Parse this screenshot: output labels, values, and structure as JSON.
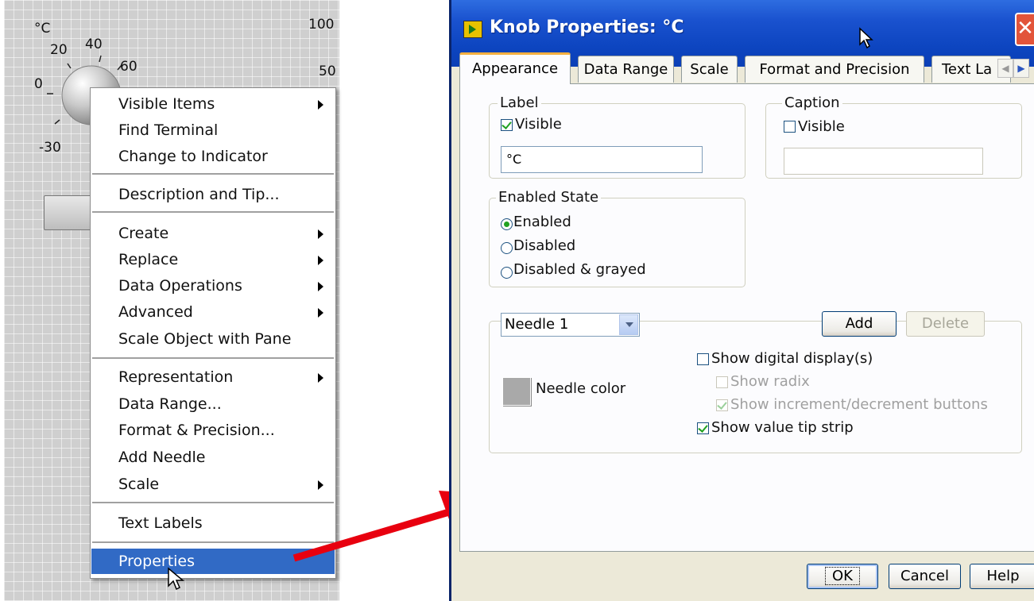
{
  "front_panel": {
    "knob_label": "°C",
    "knob_ticks": [
      "-30",
      "0",
      "20",
      "40",
      "60"
    ],
    "scale_ticks": [
      "100",
      "50"
    ]
  },
  "context_menu": {
    "items": [
      {
        "label": "Visible Items",
        "submenu": true
      },
      {
        "label": "Find Terminal",
        "submenu": false
      },
      {
        "label": "Change to Indicator",
        "submenu": false
      },
      {
        "label": "Description and Tip...",
        "submenu": false
      },
      {
        "label": "Create",
        "submenu": true
      },
      {
        "label": "Replace",
        "submenu": true
      },
      {
        "label": "Data Operations",
        "submenu": true
      },
      {
        "label": "Advanced",
        "submenu": true
      },
      {
        "label": "Scale Object with Pane",
        "submenu": false
      },
      {
        "label": "Representation",
        "submenu": true
      },
      {
        "label": "Data Range...",
        "submenu": false
      },
      {
        "label": "Format & Precision...",
        "submenu": false
      },
      {
        "label": "Add Needle",
        "submenu": false
      },
      {
        "label": "Scale",
        "submenu": true
      },
      {
        "label": "Text Labels",
        "submenu": false
      },
      {
        "label": "Properties",
        "submenu": false,
        "selected": true
      }
    ]
  },
  "dialog": {
    "title": "Knob Properties: °C",
    "close_glyph": "✕",
    "tabs": [
      {
        "label": "Appearance",
        "active": true
      },
      {
        "label": "Data Range",
        "active": false
      },
      {
        "label": "Scale",
        "active": false
      },
      {
        "label": "Format and Precision",
        "active": false
      },
      {
        "label": "Text La",
        "active": false
      }
    ],
    "tab_scroll": {
      "left": "◀",
      "right": "▶"
    },
    "label_group": {
      "legend": "Label",
      "visible_label": "Visible",
      "visible_checked": true,
      "value": "°C"
    },
    "caption_group": {
      "legend": "Caption",
      "visible_label": "Visible",
      "visible_checked": false,
      "value": ""
    },
    "enabled_state": {
      "legend": "Enabled State",
      "options": [
        "Enabled",
        "Disabled",
        "Disabled & grayed"
      ],
      "selected": "Enabled"
    },
    "needle": {
      "selected": "Needle 1",
      "add_label": "Add",
      "delete_label": "Delete",
      "color_label": "Needle color",
      "color": "#a9a9a9",
      "show_digital_display": {
        "label": "Show digital display(s)",
        "checked": false
      },
      "show_radix": {
        "label": "Show radix",
        "checked": false,
        "disabled": true
      },
      "show_incdec": {
        "label": "Show increment/decrement buttons",
        "checked": true,
        "disabled": true
      },
      "show_value_tip": {
        "label": "Show value tip strip",
        "checked": true
      }
    },
    "buttons": {
      "ok": "OK",
      "cancel": "Cancel",
      "help": "Help"
    }
  },
  "colors": {
    "titlebar": "#0d45c0",
    "menu_highlight": "#316ac5",
    "arrow": "#e8000f",
    "check": "#21a121"
  }
}
